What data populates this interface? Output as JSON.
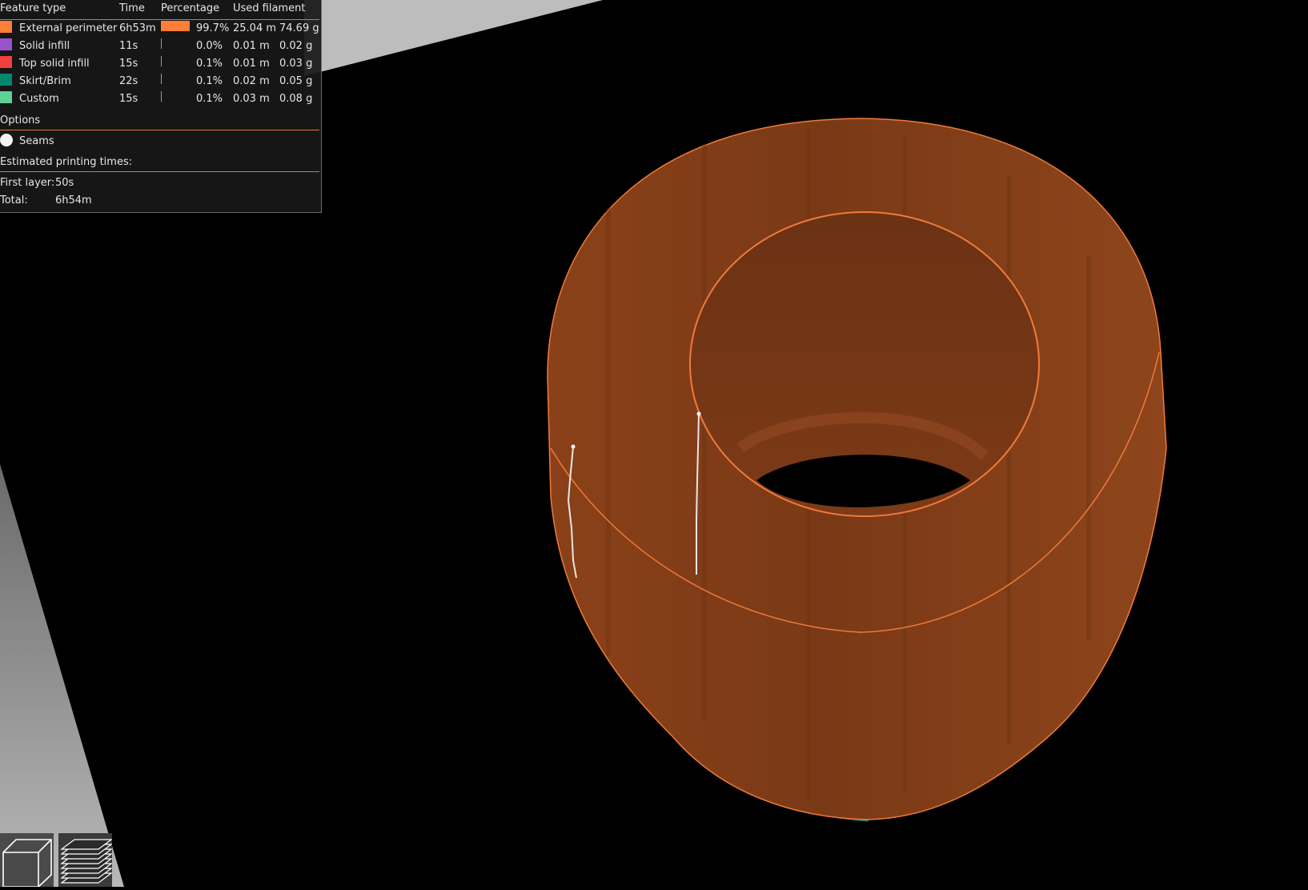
{
  "legend": {
    "headers": {
      "feature_type": "Feature type",
      "time": "Time",
      "percentage": "Percentage",
      "used_filament": "Used filament"
    },
    "features": [
      {
        "name": "External perimeter",
        "time": "6h53m",
        "percentage": "99.7%",
        "length": "25.04 m",
        "weight": "74.69 g",
        "color": "#ff7d38",
        "fraction": 0.997
      },
      {
        "name": "Solid infill",
        "time": "11s",
        "percentage": "0.0%",
        "length": "0.01 m",
        "weight": "0.02 g",
        "color": "#9654cc",
        "fraction": 0.0
      },
      {
        "name": "Top solid infill",
        "time": "15s",
        "percentage": "0.1%",
        "length": "0.01 m",
        "weight": "0.03 g",
        "color": "#f04040",
        "fraction": 0.001
      },
      {
        "name": "Skirt/Brim",
        "time": "22s",
        "percentage": "0.1%",
        "length": "0.02 m",
        "weight": "0.05 g",
        "color": "#00876e",
        "fraction": 0.001
      },
      {
        "name": "Custom",
        "time": "15s",
        "percentage": "0.1%",
        "length": "0.03 m",
        "weight": "0.08 g",
        "color": "#5ed194",
        "fraction": 0.001
      }
    ],
    "options_title": "Options",
    "seams_label": "Seams",
    "estimated_title": "Estimated printing times:",
    "first_layer_label": "First layer:",
    "first_layer_value": "50s",
    "total_label": "Total:",
    "total_value": "6h54m"
  },
  "view_buttons": {
    "icons": [
      "3d-view-icon",
      "layers-view-icon"
    ]
  },
  "colors": {
    "accent": "#e07436",
    "model": "#7a3a17",
    "model_rim": "#f07a3a",
    "skirt": "#0a8a76",
    "bed": "#9a9a9a"
  }
}
